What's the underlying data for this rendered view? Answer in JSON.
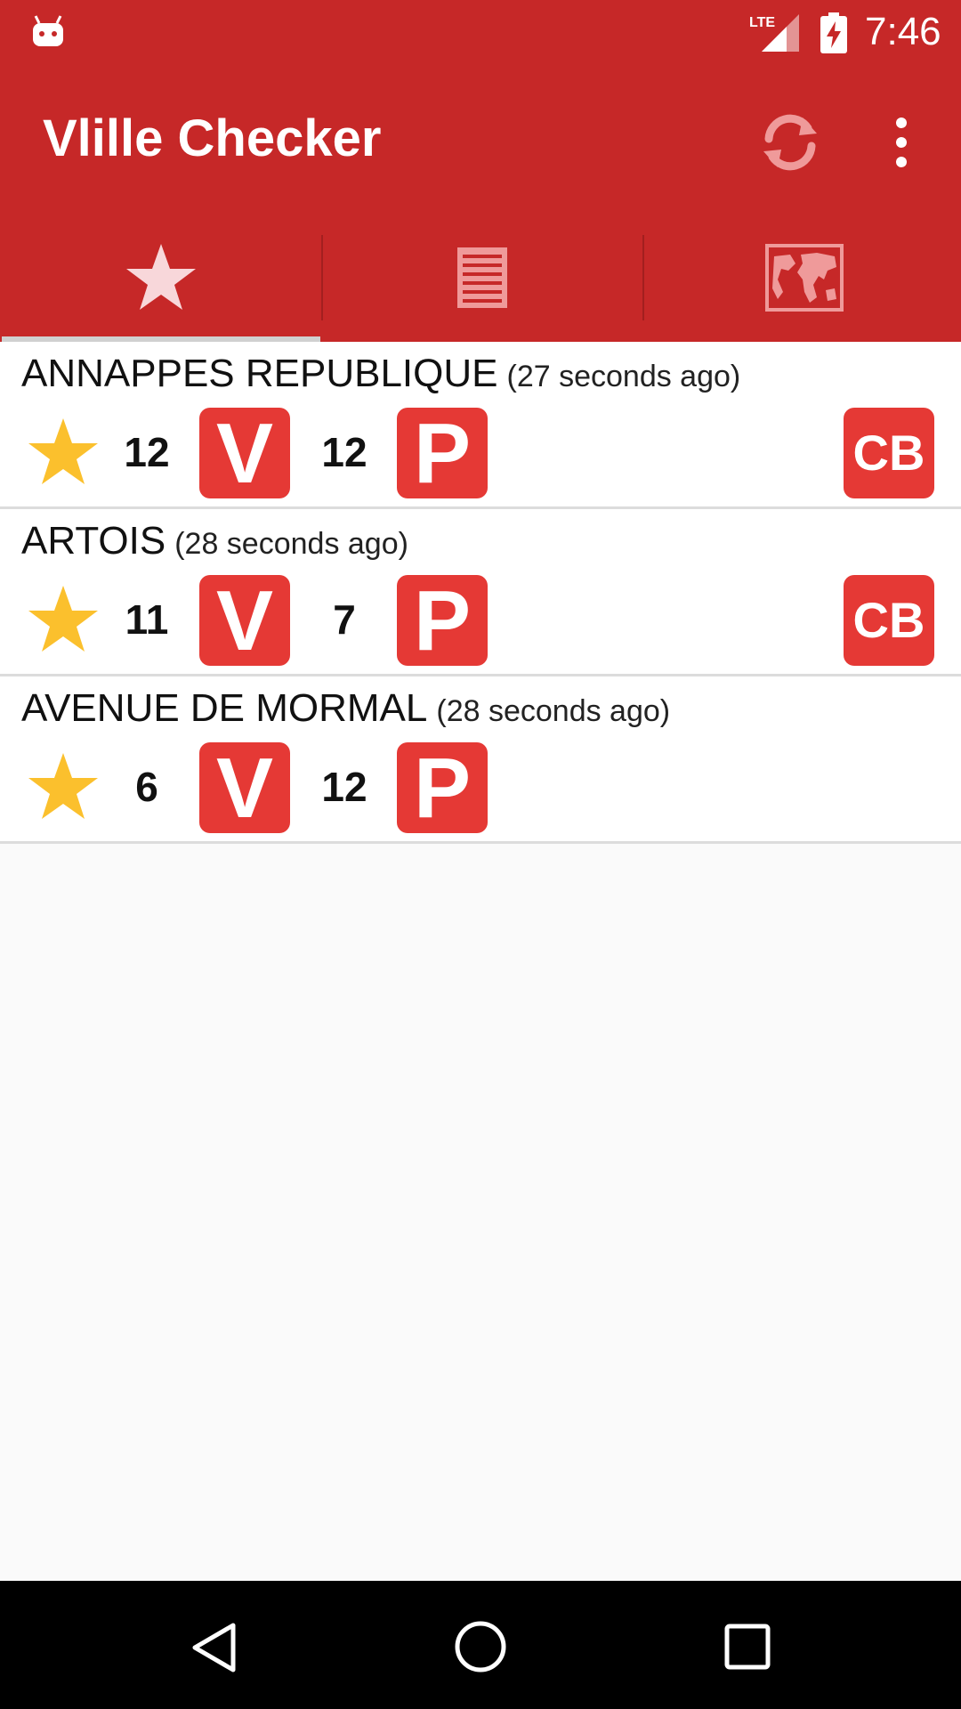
{
  "status_bar": {
    "time": "7:46",
    "network": "LTE",
    "icons": [
      "android-notification-icon",
      "lte-signal-icon",
      "battery-charging-icon"
    ]
  },
  "toolbar": {
    "title": "Vlille Checker",
    "actions": [
      "refresh-icon",
      "more-vert-icon"
    ]
  },
  "tabs": [
    {
      "icon": "star-icon",
      "selected": true
    },
    {
      "icon": "list-icon",
      "selected": false
    },
    {
      "icon": "map-icon",
      "selected": false
    }
  ],
  "colors": {
    "primary": "#c62828",
    "badge": "#e53935",
    "star": "#fbc02d",
    "background": "#fafafa"
  },
  "stations": [
    {
      "name": "ANNAPPES REPUBLIQUE",
      "ago": "(27 seconds ago)",
      "bikes": "12",
      "bikes_badge": "V",
      "places": "12",
      "places_badge": "P",
      "cb": "CB",
      "favorite": true
    },
    {
      "name": "ARTOIS",
      "ago": "(28 seconds ago)",
      "bikes": "11",
      "bikes_badge": "V",
      "places": "7",
      "places_badge": "P",
      "cb": "CB",
      "favorite": true
    },
    {
      "name": "AVENUE DE MORMAL",
      "ago": "(28 seconds ago)",
      "bikes": "6",
      "bikes_badge": "V",
      "places": "12",
      "places_badge": "P",
      "cb": null,
      "favorite": true
    }
  ],
  "nav_bar": [
    "back-icon",
    "home-icon",
    "recents-icon"
  ]
}
